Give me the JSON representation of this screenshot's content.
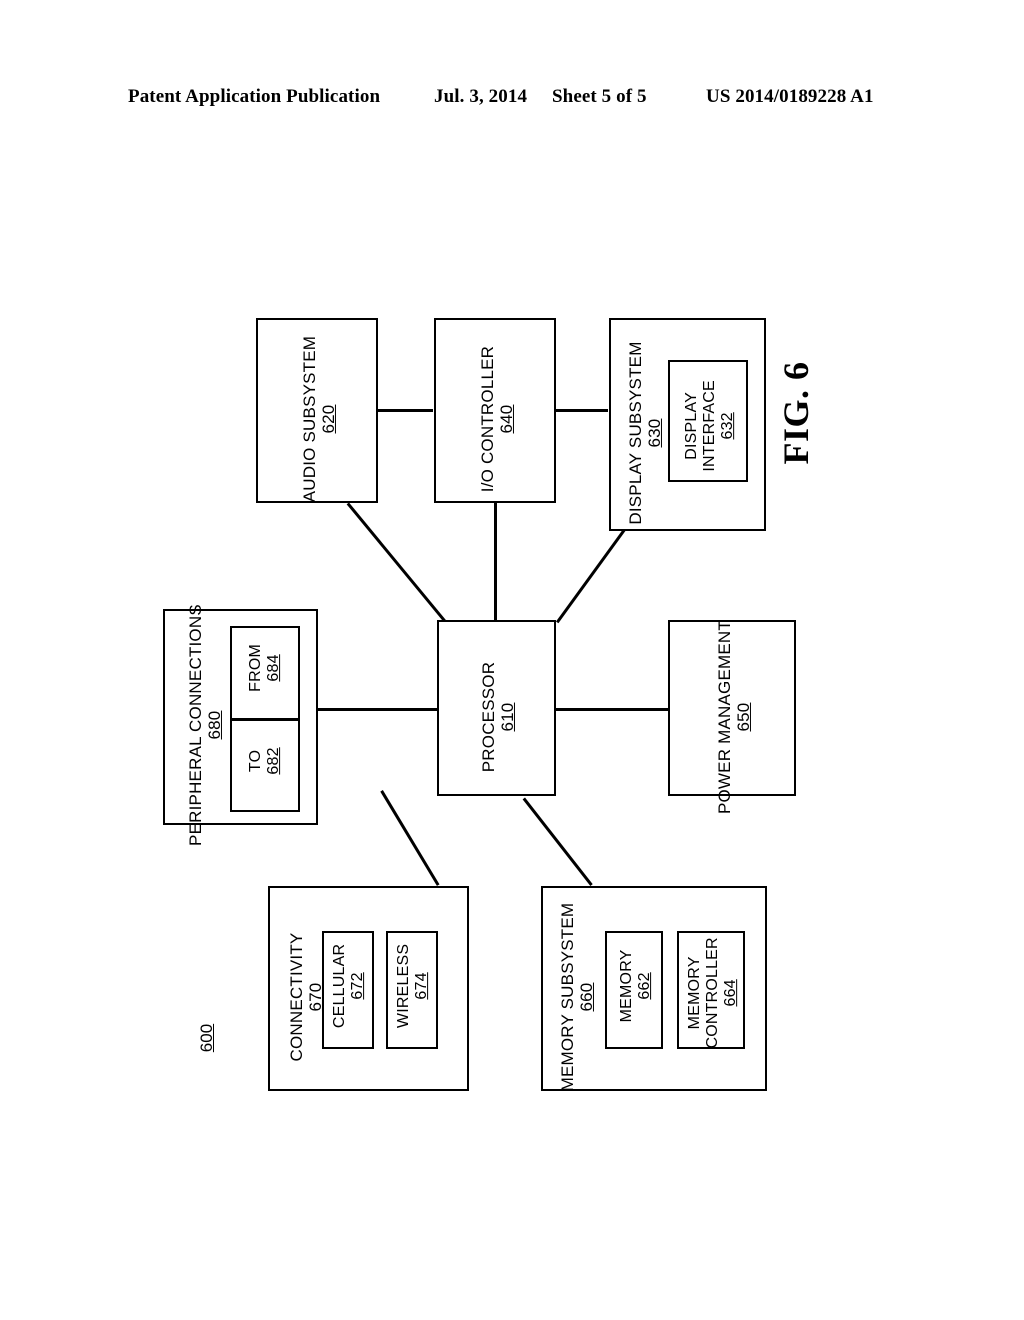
{
  "header": {
    "publication": "Patent Application Publication",
    "date": "Jul. 3, 2014",
    "sheet": "Sheet 5 of 5",
    "patent_number": "US 2014/0189228 A1"
  },
  "figure": {
    "caption": "FIG. 6",
    "system_ref": "600"
  },
  "blocks": {
    "audio_subsystem": {
      "label": "AUDIO SUBSYSTEM",
      "ref": "620"
    },
    "io_controller": {
      "label": "I/O CONTROLLER",
      "ref": "640"
    },
    "display_subsystem": {
      "label": "DISPLAY SUBSYSTEM",
      "ref": "630"
    },
    "display_interface": {
      "label": "DISPLAY\nINTERFACE",
      "ref": "632"
    },
    "peripheral_connections": {
      "label": "PERIPHERAL CONNECTIONS",
      "ref": "680"
    },
    "peripheral_to": {
      "label": "TO",
      "ref": "682"
    },
    "peripheral_from": {
      "label": "FROM",
      "ref": "684"
    },
    "processor": {
      "label": "PROCESSOR",
      "ref": "610"
    },
    "power_management": {
      "label": "POWER MANAGEMENT",
      "ref": "650"
    },
    "connectivity": {
      "label": "CONNECTIVITY",
      "ref": "670"
    },
    "cellular": {
      "label": "CELLULAR",
      "ref": "672"
    },
    "wireless": {
      "label": "WIRELESS",
      "ref": "674"
    },
    "memory_subsystem": {
      "label": "MEMORY SUBSYSTEM",
      "ref": "660"
    },
    "memory": {
      "label": "MEMORY",
      "ref": "662"
    },
    "memory_controller": {
      "label": "MEMORY\nCONTROLLER",
      "ref": "664"
    }
  },
  "display_interface_lines": {
    "line1": "DISPLAY",
    "line2": "INTERFACE"
  },
  "memory_controller_lines": {
    "line1": "MEMORY",
    "line2": "CONTROLLER"
  },
  "colors": {
    "stroke": "#000000",
    "background": "#ffffff"
  }
}
